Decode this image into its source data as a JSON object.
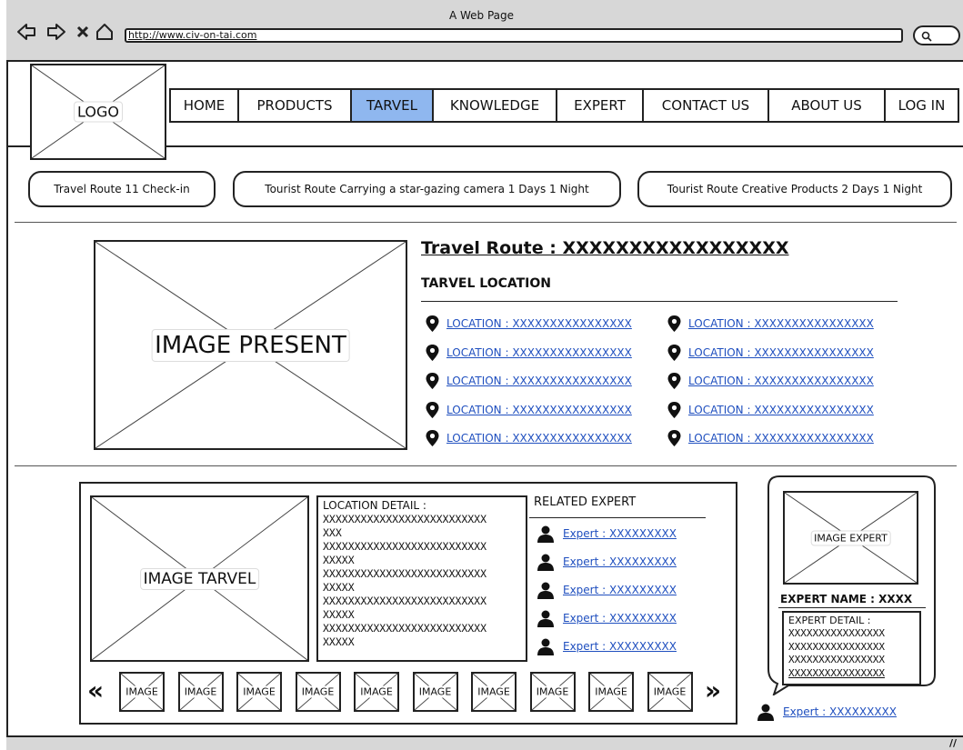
{
  "window": {
    "title": "A Web Page",
    "url": "http://www.civ-on-tai.com"
  },
  "logo": {
    "label": "LOGO"
  },
  "nav": [
    "HOME",
    "PRODUCTS",
    "TARVEL",
    "KNOWLEDGE",
    "EXPERT",
    "CONTACT US",
    "ABOUT US",
    "LOG IN"
  ],
  "nav_active": "TARVEL",
  "route_tabs": [
    "Travel Route 11 Check-in",
    "Tourist Route Carrying a star-gazing camera 1 Days 1 Night",
    "Tourist Route Creative Products 2 Days 1 Night"
  ],
  "main_image": {
    "label": "IMAGE PRESENT"
  },
  "route": {
    "title": "Travel Route : XXXXXXXXXXXXXXXXX",
    "location_heading": "TARVEL LOCATION"
  },
  "locations_left": [
    "LOCATION : XXXXXXXXXXXXXXXX",
    "LOCATION : XXXXXXXXXXXXXXXX",
    "LOCATION : XXXXXXXXXXXXXXXX",
    "LOCATION : XXXXXXXXXXXXXXXX",
    "LOCATION : XXXXXXXXXXXXXXXX"
  ],
  "locations_right": [
    "LOCATION : XXXXXXXXXXXXXXXX",
    "LOCATION : XXXXXXXXXXXXXXXX",
    "LOCATION : XXXXXXXXXXXXXXXX",
    "LOCATION : XXXXXXXXXXXXXXXX",
    "LOCATION : XXXXXXXXXXXXXXXX"
  ],
  "travel_image": {
    "label": "IMAGE TARVEL"
  },
  "location_detail": {
    "heading": "LOCATION  DETAIL :",
    "lines": [
      "XXXXXXXXXXXXXXXXXXXXXXXXXX",
      "XXX",
      "XXXXXXXXXXXXXXXXXXXXXXXXXX",
      "XXXXX",
      "XXXXXXXXXXXXXXXXXXXXXXXXXX",
      "XXXXX",
      "XXXXXXXXXXXXXXXXXXXXXXXXXX",
      "XXXXX",
      "XXXXXXXXXXXXXXXXXXXXXXXXXX",
      "XXXXX"
    ]
  },
  "related_expert": {
    "heading": "RELATED EXPERT",
    "items": [
      "Expert : XXXXXXXXX",
      "Expert : XXXXXXXXX",
      "Expert : XXXXXXXXX",
      "Expert : XXXXXXXXX",
      "Expert : XXXXXXXXX"
    ]
  },
  "thumbnails": [
    "IMAGE",
    "IMAGE",
    "IMAGE",
    "IMAGE",
    "IMAGE",
    "IMAGE",
    "IMAGE",
    "IMAGE",
    "IMAGE",
    "IMAGE"
  ],
  "gallery_prev": "«",
  "gallery_next": "»",
  "expert_card": {
    "image_label": "IMAGE EXPERT",
    "name": "EXPERT NAME : XXXX",
    "detail_heading": "EXPERT  DETAIL :",
    "detail_lines": [
      "XXXXXXXXXXXXXXXX",
      "XXXXXXXXXXXXXXXX",
      "XXXXXXXXXXXXXXXX",
      "XXXXXXXXXXXXXXXX"
    ],
    "link": "Expert : XXXXXXXXX"
  },
  "colors": {
    "active_tab": "#8fb7ef",
    "link": "#1f4fbf",
    "chrome": "#d7d7d7"
  }
}
